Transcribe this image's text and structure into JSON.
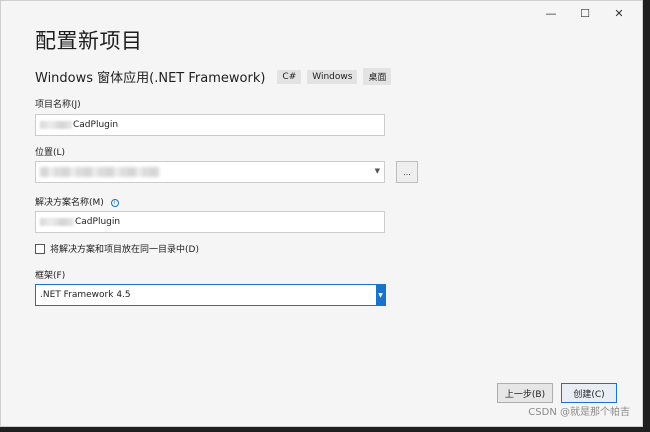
{
  "window": {
    "controls": {
      "minimize": "—",
      "maximize": "☐",
      "close": "✕"
    }
  },
  "page": {
    "title": "配置新项目",
    "subtitle": "Windows 窗体应用(.NET Framework)",
    "tags": [
      "C#",
      "Windows",
      "桌面"
    ]
  },
  "form": {
    "project_name_label": "项目名称(J)",
    "project_name_value": "CadPlugin",
    "location_label": "位置(L)",
    "browse_label": "...",
    "solution_name_label": "解决方案名称(M)",
    "solution_name_value": "CadPlugin",
    "same_dir_checkbox_label": "将解决方案和项目放在同一目录中(D)",
    "framework_label": "框架(F)",
    "framework_value": ".NET Framework 4.5"
  },
  "footer": {
    "back_label": "上一步(B)",
    "create_label": "创建(C)"
  },
  "watermark": "CSDN @就是那个帕吉",
  "colors": {
    "accent": "#1a73c8",
    "background": "#f5f5f5"
  }
}
